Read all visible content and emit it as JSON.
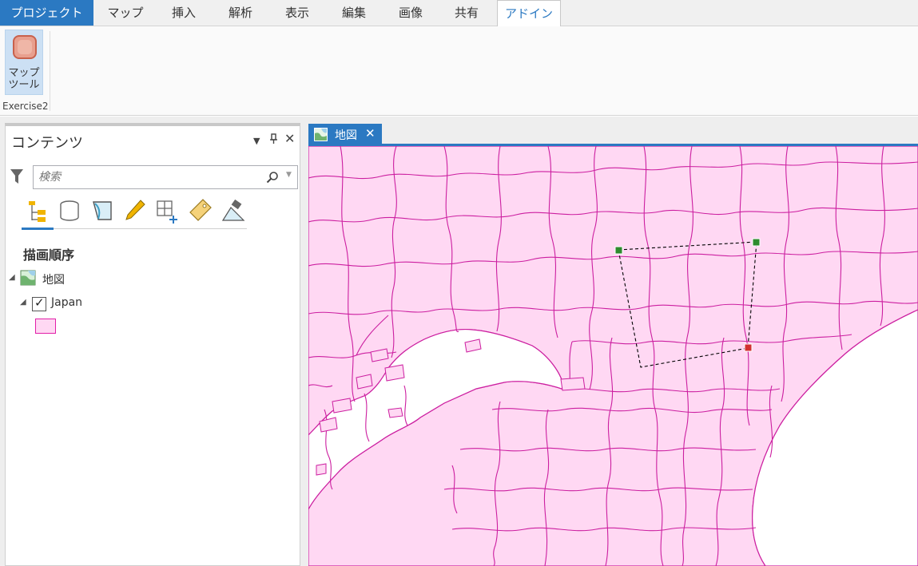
{
  "ribbon_tabs": [
    {
      "label": "プロジェクト"
    },
    {
      "label": "マップ"
    },
    {
      "label": "挿入"
    },
    {
      "label": "解析"
    },
    {
      "label": "表示"
    },
    {
      "label": "編集"
    },
    {
      "label": "画像"
    },
    {
      "label": "共有"
    },
    {
      "label": "アドイン"
    }
  ],
  "active_tab": "アドイン",
  "ribbon": {
    "tool_label_line1": "マップ",
    "tool_label_line2": "ツール",
    "group_label": "Exercise2"
  },
  "contents_pane": {
    "title": "コンテンツ",
    "search_placeholder": "検索",
    "section_title": "描画順序",
    "map_item": "地図",
    "layer_item": "Japan",
    "layer_checked": true,
    "view_buttons": [
      "list-by-drawing-order-icon",
      "list-by-source-icon",
      "list-by-selection-icon",
      "list-by-editing-icon",
      "list-by-snapping-icon",
      "list-by-labeling-icon",
      "list-by-perspective-imagery-icon"
    ]
  },
  "map_view": {
    "tab_label": "地図",
    "fill_color": "#ffd8f3",
    "boundary_color": "#cc1fa0",
    "water_color": "#ffffff"
  },
  "colors": {
    "accent": "#2b79c2",
    "selection_handle_green": "#2e8b2e",
    "selection_handle_red": "#d23030"
  }
}
